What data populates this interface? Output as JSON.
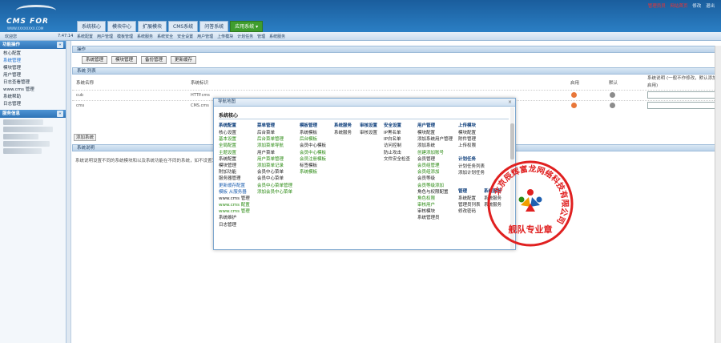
{
  "header": {
    "logo": "CMS FOR",
    "logo_sub": "WWW.XXXXXXXX.COM",
    "top_links": [
      "管理员员",
      "网站首页",
      "修改",
      "退出"
    ],
    "nav_tabs": [
      "系统核心",
      "模块中心",
      "扩展模块",
      "CMS系统",
      "问答系统",
      "应用系统 ▾"
    ],
    "active_tab": "应用系统 ▾"
  },
  "subbar": {
    "welcome": "欢迎您",
    "time": "7:47:14",
    "links": [
      "系统配置",
      "用户管理",
      "模板管理",
      "系统服务",
      "系统安全",
      "安全设置",
      "用户管理",
      "上传模块",
      "计划任务",
      "管理",
      "系统服务"
    ]
  },
  "sidebar": {
    "panel1_title": "功能操作",
    "items": [
      "核心配置",
      "系统管理",
      "模块管理",
      "用户管理",
      "日志查看管理",
      "www.cms 管理",
      "系统帮助",
      "日志管理"
    ],
    "active_index": 1,
    "panel2_title": "服务信息",
    "collapse_glyph": "«"
  },
  "main": {
    "section1": "操作",
    "buttons": [
      "系统管理",
      "模块管理",
      "备份管理",
      "更新缓存"
    ],
    "section2": "系统 列表",
    "columns": [
      "系统名称",
      "系统标识",
      "启用",
      "默认",
      "系统说明"
    ],
    "rows": [
      {
        "name": "cub",
        "id": "HTTP.cms"
      },
      {
        "name": "cms",
        "id": "CMS.cms"
      }
    ],
    "note": "(一般不作修改，默认添加)",
    "note2": "启用)",
    "add_btn": "添加系统",
    "section3": "系统说明",
    "desc": "系统说明设置不同的系统模块和以及系统功能在不同的系统，如不设置为系统会系统..."
  },
  "popup": {
    "title": "导航地图",
    "subtitle": "系统核心",
    "close": "×",
    "columns": [
      {
        "head": "系统配置",
        "items": [
          {
            "t": "核心设置",
            "c": ""
          },
          {
            "t": "基本设置",
            "c": "g"
          },
          {
            "t": "全局配置",
            "c": "g"
          },
          {
            "t": "主题设置",
            "c": "g"
          },
          {
            "t": "系统配置",
            "c": ""
          },
          {
            "t": "模块管理",
            "c": ""
          },
          {
            "t": "附加功能",
            "c": ""
          },
          {
            "t": "服务器管理",
            "c": ""
          },
          {
            "t": "更新缓存配置",
            "c": "b"
          },
          {
            "t": "模板 从服务器",
            "c": "b"
          },
          {
            "t": "www.cms 管理",
            "c": ""
          },
          {
            "t": "www.cms 配置",
            "c": "g"
          },
          {
            "t": "www.cms 管理",
            "c": "g"
          },
          {
            "t": "系统维护",
            "c": ""
          },
          {
            "t": "日志管理",
            "c": ""
          }
        ]
      },
      {
        "head": "菜单管理",
        "items": [
          {
            "t": "后台菜单",
            "c": ""
          },
          {
            "t": "后台菜单管理",
            "c": "g"
          },
          {
            "t": "添加菜单导航",
            "c": "g"
          },
          {
            "t": "用户菜单",
            "c": ""
          },
          {
            "t": "用户菜单管理",
            "c": "g"
          },
          {
            "t": "添加菜单记录",
            "c": "g"
          },
          {
            "t": "会员中心菜单",
            "c": ""
          },
          {
            "t": "会员中心菜单",
            "c": ""
          },
          {
            "t": "会员中心菜单管理",
            "c": "g"
          },
          {
            "t": "添加会员中心菜单",
            "c": "g"
          }
        ]
      },
      {
        "head": "模板管理",
        "items": [
          {
            "t": "系统模板",
            "c": ""
          },
          {
            "t": "后台模板",
            "c": "g"
          },
          {
            "t": "会员中心模板",
            "c": ""
          },
          {
            "t": "会员中心模板",
            "c": "g"
          },
          {
            "t": "会员注册模板",
            "c": "g"
          },
          {
            "t": "标签模板",
            "c": ""
          },
          {
            "t": "系统模板",
            "c": "g"
          }
        ]
      },
      {
        "head": "系统服务",
        "items": [
          {
            "t": "系统服务",
            "c": ""
          }
        ]
      },
      {
        "head": "审核设置",
        "items": [
          {
            "t": "审核设置",
            "c": ""
          }
        ]
      },
      {
        "head": "安全设置",
        "items": [
          {
            "t": "IP黑名单",
            "c": ""
          },
          {
            "t": "IP白名单",
            "c": ""
          },
          {
            "t": "访问控制",
            "c": ""
          },
          {
            "t": "防止攻击",
            "c": ""
          },
          {
            "t": "文件安全检查",
            "c": ""
          }
        ]
      },
      {
        "head": "用户管理",
        "items": [
          {
            "t": "模块配置",
            "c": ""
          },
          {
            "t": "添加系统用户管理",
            "c": ""
          },
          {
            "t": "添加系统",
            "c": ""
          },
          {
            "t": "创建添加账号",
            "c": "g"
          },
          {
            "t": "会员管理",
            "c": ""
          },
          {
            "t": "会员组管理",
            "c": "g"
          },
          {
            "t": "会员组添加",
            "c": "g"
          },
          {
            "t": "会员等级",
            "c": ""
          },
          {
            "t": "会员等级添加",
            "c": "g"
          },
          {
            "t": "角色与权限配置",
            "c": ""
          },
          {
            "t": "角色权限",
            "c": "g"
          },
          {
            "t": "审核用户",
            "c": "g"
          },
          {
            "t": "审核模块",
            "c": ""
          },
          {
            "t": "系统管理员",
            "c": ""
          }
        ]
      },
      {
        "head": "上传模块",
        "items": [
          {
            "t": "模块配置",
            "c": ""
          },
          {
            "t": "附件管理",
            "c": ""
          },
          {
            "t": "上传权限",
            "c": ""
          }
        ]
      },
      {
        "head": "计划任务",
        "items": [
          {
            "t": "计划任务列表",
            "c": ""
          },
          {
            "t": "添加计划任务",
            "c": ""
          }
        ]
      },
      {
        "head": "管理",
        "items": [
          {
            "t": "系统配置",
            "c": ""
          },
          {
            "t": "管理员列表",
            "c": ""
          },
          {
            "t": "修改密码",
            "c": ""
          }
        ]
      },
      {
        "head": "系统服务",
        "items": [
          {
            "t": "系统服务",
            "c": ""
          },
          {
            "t": "系统服务",
            "c": ""
          }
        ]
      }
    ]
  },
  "stamp": {
    "ring_text": "北京辰辉富龙网络科技有限公司",
    "center_text": "舰队专业章",
    "color": "#e02020"
  }
}
